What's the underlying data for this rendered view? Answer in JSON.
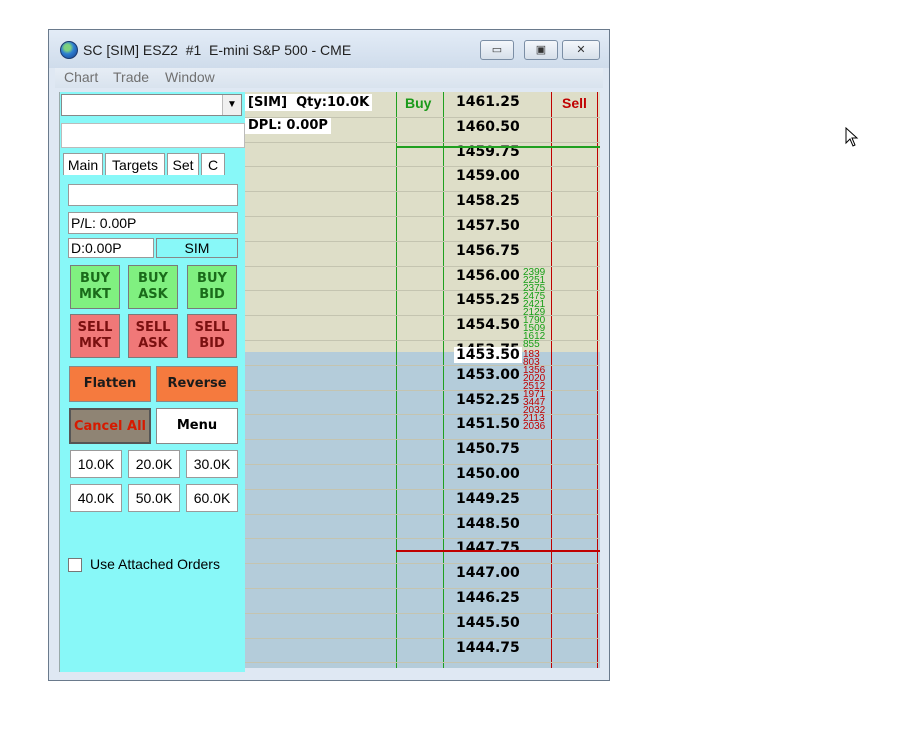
{
  "window": {
    "title": "SC [SIM] ESZ2  #1  E-mini S&P 500 - CME",
    "controls": [
      "▭",
      "▣",
      "✕"
    ]
  },
  "menu": [
    "Chart",
    "Trade",
    "Window"
  ],
  "panel": {
    "tabs": [
      "Main",
      "Targets",
      "Set",
      "C"
    ],
    "pl": "P/L: 0.00P",
    "daily": "D:0.00P",
    "mode": "SIM",
    "buy_buttons": [
      [
        "BUY",
        "MKT"
      ],
      [
        "BUY",
        "ASK"
      ],
      [
        "BUY",
        "BID"
      ]
    ],
    "sell_buttons": [
      [
        "SELL",
        "MKT"
      ],
      [
        "SELL",
        "ASK"
      ],
      [
        "SELL",
        "BID"
      ]
    ],
    "flatten": "Flatten",
    "reverse": "Reverse",
    "cancel_all": "Cancel All",
    "menu_btn": "Menu",
    "qty": [
      "10.0K",
      "20.0K",
      "30.0K",
      "40.0K",
      "50.0K",
      "60.0K"
    ],
    "attached": "Use Attached Orders"
  },
  "dom": {
    "position": "[SIM]  Qty:10.0K",
    "dpl": "DPL: 0.00P",
    "buy_header": "Buy",
    "sell_header": "Sell",
    "prices": [
      "1461.25",
      "1460.50",
      "1459.75",
      "1459.00",
      "1458.25",
      "1457.50",
      "1456.75",
      "1456.00",
      "1455.25",
      "1454.50",
      "1453.75",
      "1453.00",
      "1452.25",
      "1451.50",
      "1450.75",
      "1450.00",
      "1449.25",
      "1448.50",
      "1447.75",
      "1447.00",
      "1446.25",
      "1445.50",
      "1444.75"
    ],
    "last_price": "1453.50",
    "volume_green": [
      "2399",
      "2251",
      "2375",
      "2475",
      "2421",
      "2129",
      "1790",
      "1509",
      "1612",
      "855"
    ],
    "volume_red": [
      "183",
      "803",
      "1356",
      "2020",
      "2512",
      "1971",
      "3447",
      "2032",
      "2113",
      "2036"
    ],
    "colors": {
      "ask_bg": "#dedec8",
      "bid_bg": "#b4ccda",
      "panel": "#88f8f8"
    }
  }
}
